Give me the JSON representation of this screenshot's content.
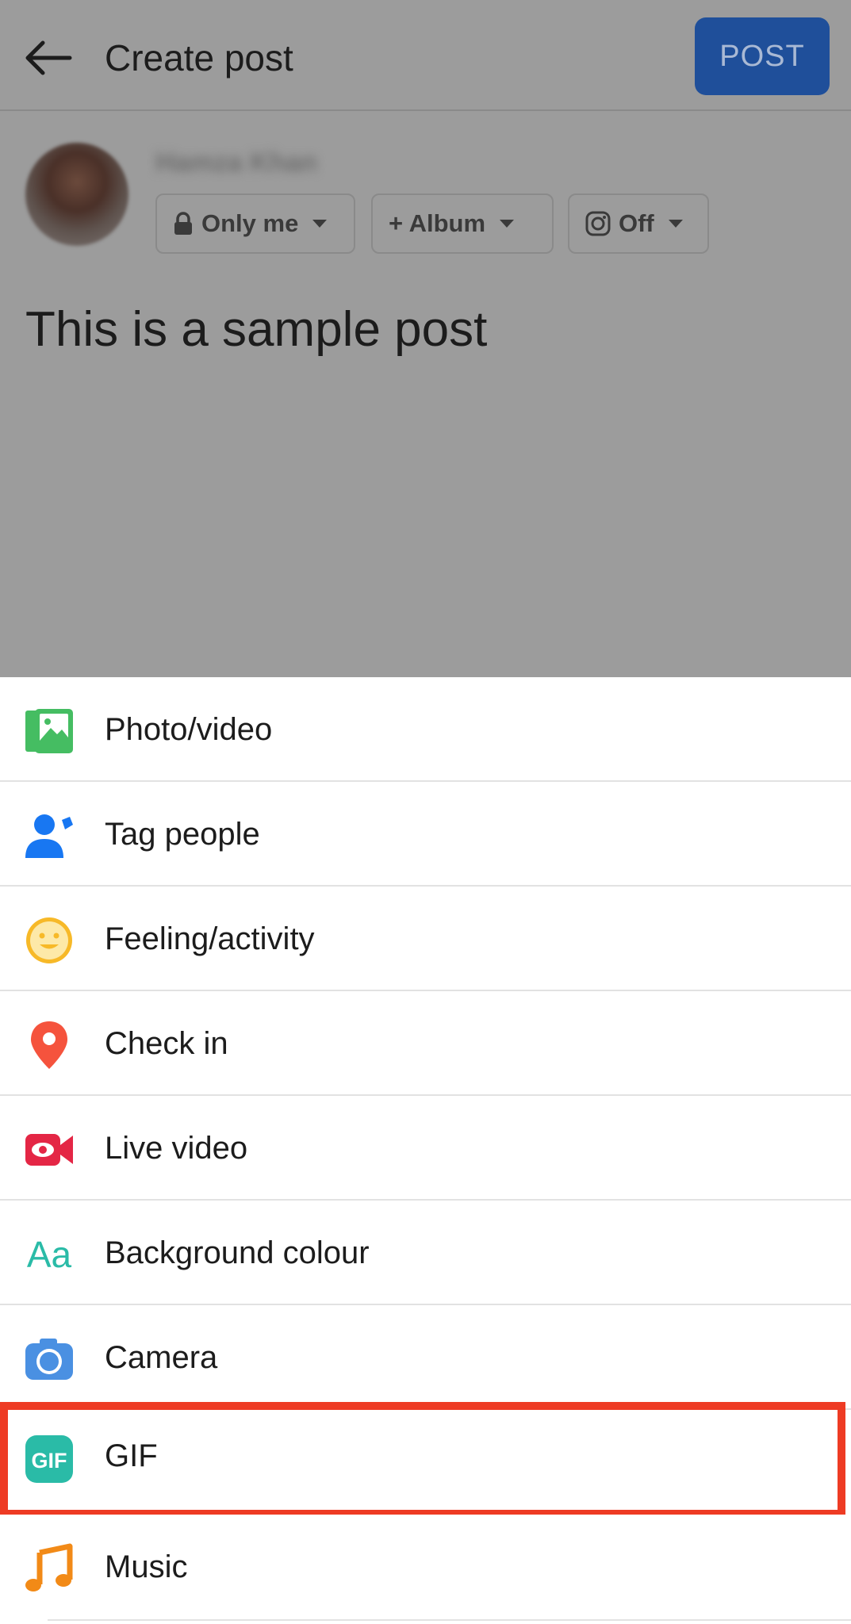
{
  "header": {
    "title": "Create post",
    "post_label": "POST"
  },
  "composer": {
    "username": "Hamza Khan",
    "chips": {
      "privacy": "Only me",
      "album": "+ Album",
      "instagram": "Off"
    },
    "post_text": "This is a sample post"
  },
  "options": [
    {
      "label": "Photo/video",
      "icon": "photo-video-icon"
    },
    {
      "label": "Tag people",
      "icon": "tag-people-icon"
    },
    {
      "label": "Feeling/activity",
      "icon": "feeling-icon"
    },
    {
      "label": "Check in",
      "icon": "location-pin-icon"
    },
    {
      "label": "Live video",
      "icon": "live-video-icon"
    },
    {
      "label": "Background colour",
      "icon": "text-background-icon"
    },
    {
      "label": "Camera",
      "icon": "camera-icon"
    },
    {
      "label": "GIF",
      "icon": "gif-icon"
    },
    {
      "label": "Music",
      "icon": "music-note-icon"
    }
  ],
  "highlighted_option": "GIF",
  "colors": {
    "dim_overlay": "#9c9c9c",
    "post_button": "#1f4f9a",
    "highlight_border": "#ee3b24",
    "photo_green": "#45bd62",
    "tag_blue": "#1877f2",
    "feeling_yellow": "#f7b928",
    "checkin_red": "#f5533d",
    "live_red": "#e42645",
    "background_teal": "#2abba7",
    "camera_blue": "#4a90e2",
    "gif_teal": "#2abba7",
    "music_orange": "#f28a17"
  }
}
